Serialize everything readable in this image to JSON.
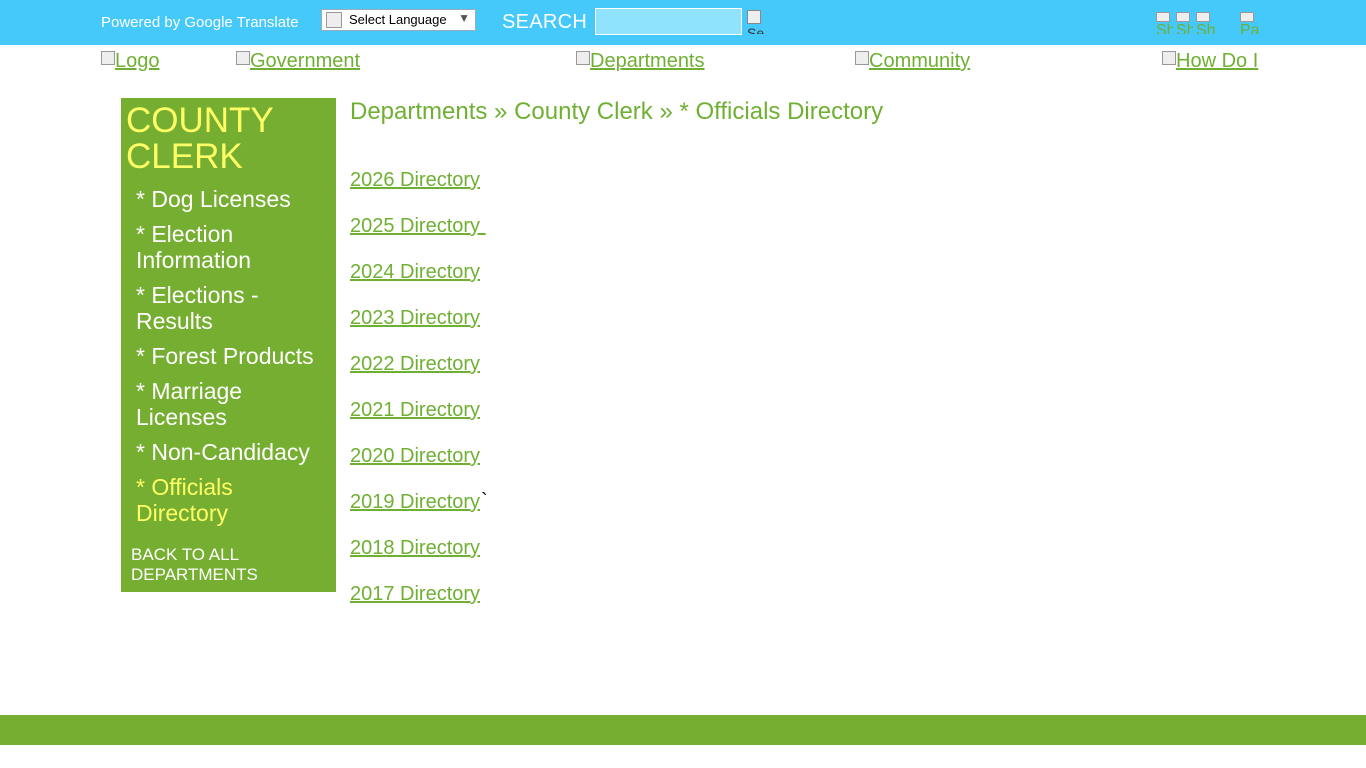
{
  "topbar": {
    "powered_by": "Powered by Google Translate",
    "language_select": "Select Language",
    "language_arrow": "▼",
    "search_label": "SEARCH",
    "search_button_alt": "Se",
    "social": [
      "Sh",
      "Sh",
      "Sh"
    ],
    "page_alt": "Pa"
  },
  "nav": {
    "logo": "Logo",
    "government": "Government",
    "departments": "Departments",
    "community": "Community",
    "how_do_i": "How Do I"
  },
  "sidebar": {
    "title": "COUNTY CLERK",
    "items": [
      {
        "label": "* Dog Licenses"
      },
      {
        "label": "* Election Information"
      },
      {
        "label": "* Elections - Results"
      },
      {
        "label": "* Forest Products"
      },
      {
        "label": "* Marriage Licenses"
      },
      {
        "label": "* Non-Candidacy"
      },
      {
        "label": "* Officials Directory"
      }
    ],
    "back": "BACK TO ALL DEPARTMENTS"
  },
  "breadcrumb": "Departments » County Clerk » * Officials Directory",
  "directories": [
    "2026 Directory",
    "2025 Directory ",
    "2024 Directory",
    "2023 Directory",
    "2022 Directory",
    "2021 Directory",
    "2020 Directory",
    "2019 Directory",
    "2018 Directory",
    "2017 Directory"
  ],
  "stray_char": "`",
  "colors": {
    "topbar": "#45c9fb",
    "green": "#75ae30",
    "link": "#6fb033",
    "highlight": "#ffff66"
  }
}
